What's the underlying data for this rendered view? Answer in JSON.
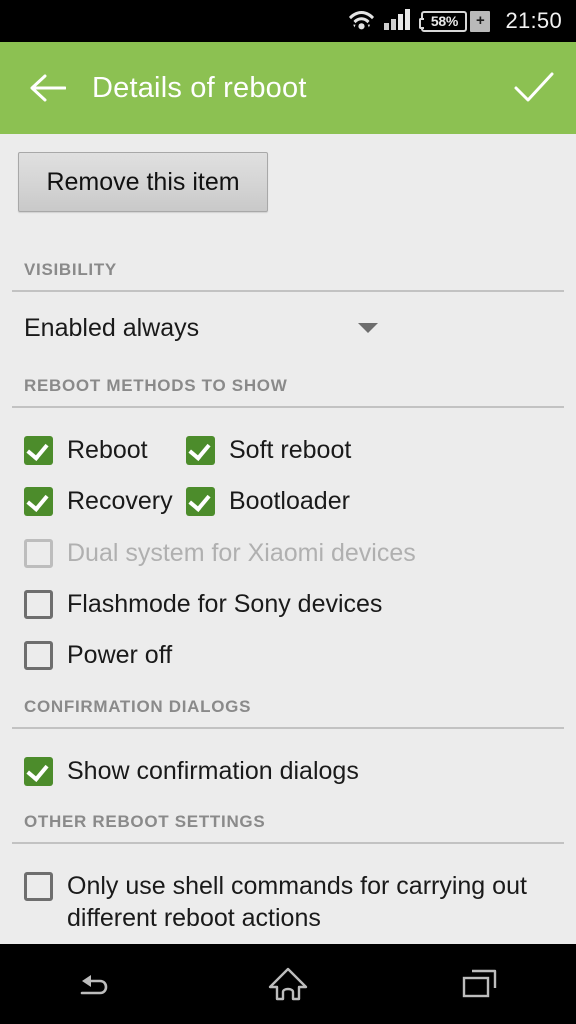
{
  "status_bar": {
    "wifi_icon": "wifi-icon",
    "signal_icon": "cellular-signal-icon",
    "battery_percent": "58%",
    "battery_charging_glyph": "+",
    "time": "21:50"
  },
  "app_bar": {
    "back_icon": "back-arrow-icon",
    "title": "Details of reboot",
    "confirm_icon": "checkmark-icon"
  },
  "content": {
    "remove_button_label": "Remove this item",
    "sections": [
      {
        "header": "VISIBILITY"
      },
      {
        "header": "REBOOT METHODS TO SHOW"
      },
      {
        "header": "CONFIRMATION DIALOGS"
      },
      {
        "header": "OTHER REBOOT SETTINGS"
      }
    ],
    "visibility_spinner": {
      "value": "Enabled always",
      "arrow_icon": "chevron-down-icon"
    },
    "reboot_methods": [
      {
        "label": "Reboot",
        "checked": true,
        "disabled": false
      },
      {
        "label": "Soft reboot",
        "checked": true,
        "disabled": false
      },
      {
        "label": "Recovery",
        "checked": true,
        "disabled": false
      },
      {
        "label": "Bootloader",
        "checked": true,
        "disabled": false
      },
      {
        "label": "Dual system for Xiaomi devices",
        "checked": false,
        "disabled": true
      },
      {
        "label": "Flashmode for Sony devices",
        "checked": false,
        "disabled": false
      },
      {
        "label": "Power off",
        "checked": false,
        "disabled": false
      }
    ],
    "confirmation": {
      "label": "Show confirmation dialogs",
      "checked": true
    },
    "other_settings": {
      "shell_commands_label": "Only use shell commands for carrying out different reboot actions",
      "checked": false
    }
  },
  "nav_bar": {
    "back_icon": "nav-back-icon",
    "home_icon": "nav-home-icon",
    "recents_icon": "nav-recents-icon"
  },
  "colors": {
    "app_bar_green": "#8cc152",
    "checkbox_green": "#4c8c2b",
    "background": "#ececec",
    "nav_black": "#000000"
  }
}
